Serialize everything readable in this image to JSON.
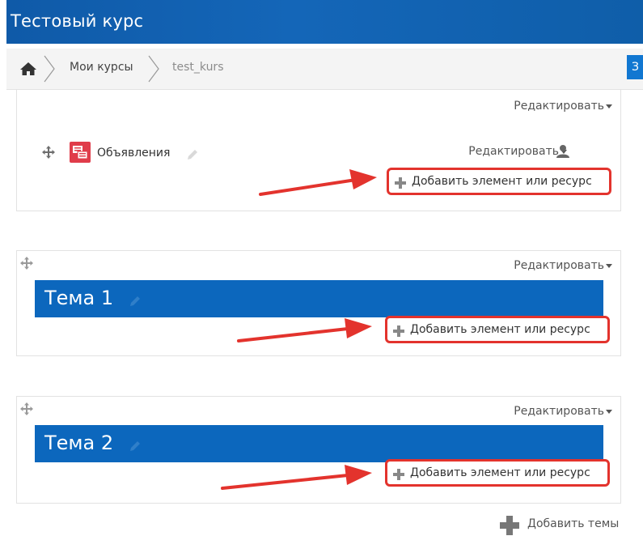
{
  "header": {
    "title": "Тестовый курс"
  },
  "breadcrumb": {
    "home_icon": "home-icon",
    "items": [
      "Мои курсы",
      "test_kurs"
    ],
    "button_label": "З"
  },
  "sections": [
    {
      "edit_label": "Редактировать",
      "activity": {
        "icon": "forum-icon",
        "name": "Объявления",
        "edit_label": "Редактировать"
      },
      "add_label": "Добавить элемент или ресурс"
    },
    {
      "edit_label": "Редактировать",
      "topic_title": "Тема 1",
      "add_label": "Добавить элемент или ресурс"
    },
    {
      "edit_label": "Редактировать",
      "topic_title": "Тема 2",
      "add_label": "Добавить элемент или ресурс"
    }
  ],
  "footer": {
    "add_topics_label": "Добавить темы"
  },
  "colors": {
    "header": "#0f5aa8",
    "topic_bar": "#0c67bd",
    "highlight": "#e3332d",
    "forum_icon": "#e03c4a"
  }
}
